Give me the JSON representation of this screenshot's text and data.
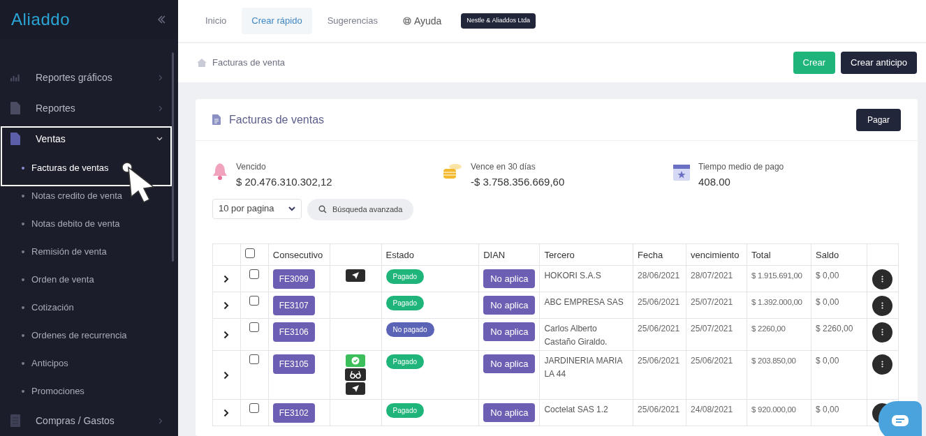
{
  "brand": {
    "name": "Aliaddo"
  },
  "sidebar": {
    "items": [
      {
        "label": "Reportes gráficos",
        "kind": "chart",
        "expanded": false
      },
      {
        "label": "Reportes",
        "kind": "report",
        "expanded": false
      },
      {
        "label": "Ventas",
        "kind": "sales",
        "expanded": true,
        "children": [
          {
            "label": "Facturas de ventas",
            "selected": true
          },
          {
            "label": "Notas credito de venta",
            "selected": false
          },
          {
            "label": "Notas debito de venta",
            "selected": false
          },
          {
            "label": "Remisión de venta",
            "selected": false
          },
          {
            "label": "Orden de venta",
            "selected": false
          },
          {
            "label": "Cotización",
            "selected": false
          },
          {
            "label": "Ordenes de recurrencia",
            "selected": false
          },
          {
            "label": "Anticipos",
            "selected": false
          },
          {
            "label": "Promociones",
            "selected": false
          }
        ]
      },
      {
        "label": "Compras / Gastos",
        "kind": "purchases",
        "expanded": false
      }
    ]
  },
  "top_nav": {
    "tabs": [
      {
        "label": "Inicio",
        "selected": false,
        "kind": "plain"
      },
      {
        "label": "Crear rápido",
        "selected": true,
        "kind": "plain"
      },
      {
        "label": "Sugerencias",
        "selected": false,
        "kind": "plain"
      },
      {
        "label": "Ayuda",
        "selected": false,
        "kind": "help"
      }
    ],
    "company": "Nestle & Aliaddos Ltda"
  },
  "breadcrumb": {
    "current": "Facturas de venta"
  },
  "actions": [
    "Crear",
    "Crear anticipo"
  ],
  "card": {
    "title": "Facturas de ventas",
    "pay_button": "Pagar",
    "stats": [
      {
        "kind": "bell",
        "label": "Vencido",
        "value": "$ 20.476.310.302,12"
      },
      {
        "kind": "coins",
        "label": "Vence en 30 días",
        "value": "-$ 3.758.356.669,60"
      },
      {
        "kind": "calendar",
        "label": "Tiempo medio de pago",
        "value": "408.00"
      }
    ],
    "page_size": "10 por pagina",
    "advanced_search": "Búsqueda avanzada"
  },
  "table": {
    "all_checked": false,
    "columns": [
      "Consecutivo",
      "Estado",
      "DIAN",
      "Tercero",
      "Fecha",
      "vencimiento",
      "Total",
      "Saldo"
    ],
    "rows": [
      {
        "id": "FE3099",
        "actions": [
          {
            "kind": "send"
          }
        ],
        "estado": {
          "label": "Pagado",
          "color": "#1fb57a"
        },
        "dian": "No aplica",
        "tercero": "HOKORI S.A.S",
        "fecha": "28/06/2021",
        "vencimiento": "28/07/2021",
        "total": "$ 1.915.691,00",
        "saldo": "$ 0,00",
        "checked": false
      },
      {
        "id": "FE3107",
        "estado": {
          "label": "Pagado",
          "color": "#1fb57a"
        },
        "dian": "No aplica",
        "tercero": "ABC EMPRESA SAS",
        "fecha": "25/06/2021",
        "vencimiento": "25/07/2021",
        "total": "$ 1.392.000,00",
        "saldo": "$ 0,00",
        "checked": false
      },
      {
        "id": "FE3106",
        "estado": {
          "label": "No pagado",
          "color": "#5b63b7"
        },
        "dian": "No aplica",
        "tercero": "Carlos Alberto Castaño Giraldo.",
        "fecha": "25/06/2021",
        "vencimiento": "25/07/2021",
        "total": "$ 2260,00",
        "saldo": "$ 2260,00",
        "checked": false
      },
      {
        "id": "FE3105",
        "actions": [
          {
            "kind": "check"
          },
          {
            "kind": "glasses"
          },
          {
            "kind": "send"
          }
        ],
        "estado": {
          "label": "Pagado",
          "color": "#1fb57a"
        },
        "dian": "No aplica",
        "tercero": "JARDINERIA MARIA LA 44",
        "fecha": "25/06/2021",
        "vencimiento": "25/06/2021",
        "total": "$ 203.850,00",
        "saldo": "$ 0,00",
        "checked": false
      },
      {
        "id": "FE3102",
        "estado": {
          "label": "Pagado",
          "color": "#1fb57a"
        },
        "dian": "No aplica",
        "tercero": "Coctelat SAS 1.2",
        "fecha": "25/06/2021",
        "vencimiento": "24/08/2021",
        "total": "$ 920.000,00",
        "saldo": "$ 0,00",
        "checked": false
      }
    ]
  }
}
